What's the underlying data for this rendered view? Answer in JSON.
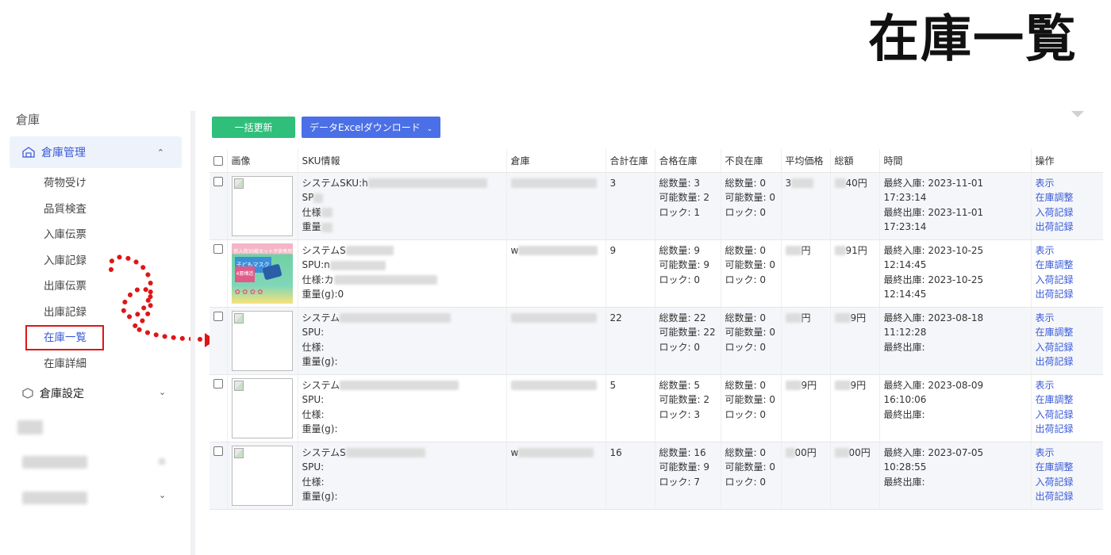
{
  "title": "在庫一覧",
  "sidebar": {
    "header": "倉庫",
    "group_active": {
      "label": "倉庫管理"
    },
    "items": [
      {
        "label": "荷物受け",
        "active": false
      },
      {
        "label": "品質検査",
        "active": false
      },
      {
        "label": "入庫伝票",
        "active": false
      },
      {
        "label": "入庫記録",
        "active": false
      },
      {
        "label": "出庫伝票",
        "active": false
      },
      {
        "label": "出庫記録",
        "active": false
      },
      {
        "label": "在庫一覧",
        "active": true
      },
      {
        "label": "在庫詳細",
        "active": false
      }
    ],
    "group2": {
      "label": "倉庫設定"
    }
  },
  "toolbar": {
    "bulk_update": "一括更新",
    "download": "データExcelダウンロード"
  },
  "table": {
    "columns": [
      "画像",
      "SKU情報",
      "倉庫",
      "合計在庫",
      "合格在庫",
      "不良在庫",
      "平均価格",
      "総額",
      "時間",
      "操作"
    ],
    "actions": [
      "表示",
      "在庫調整",
      "入荷記録",
      "出荷記録"
    ],
    "rows": [
      {
        "sku": [
          "システムSKU:h",
          "SP",
          "仕様",
          "重量"
        ],
        "total": "3",
        "good": [
          "総数量: 3",
          "可能数量: 2",
          "ロック: 1"
        ],
        "bad": [
          "総数量: 0",
          "可能数量: 0",
          "ロック: 0"
        ],
        "avg": "3",
        "sum": "40円",
        "time": [
          "最終入庫: 2023-11-01 17:23:14",
          "最終出庫: 2023-11-01 17:23:14"
        ],
        "image": "broken"
      },
      {
        "sku": [
          "システムS",
          "SPU:n",
          "仕様:カ",
          "重量(g):0"
        ],
        "warehouse": "w",
        "total": "9",
        "good": [
          "総数量: 9",
          "可能数量: 9",
          "ロック: 0"
        ],
        "bad": [
          "総数量: 0",
          "可能数量: 0",
          "ロック: 0"
        ],
        "avg": "円",
        "sum": "91円",
        "time": [
          "最終入庫: 2023-10-25 12:14:45",
          "最終出庫: 2023-10-25 12:14:45"
        ],
        "image": "product",
        "image_text": [
          "新入荷30枚セット子供専用",
          "子どもマスク",
          "4層構造"
        ]
      },
      {
        "sku": [
          "システム",
          "SPU:",
          "仕様:",
          "重量(g):"
        ],
        "total": "22",
        "good": [
          "総数量: 22",
          "可能数量: 22",
          "ロック: 0"
        ],
        "bad": [
          "総数量: 0",
          "可能数量: 0",
          "ロック: 0"
        ],
        "avg": "円",
        "sum": "9円",
        "time": [
          "最終入庫: 2023-08-18 11:12:28",
          "最終出庫:"
        ],
        "image": "broken"
      },
      {
        "sku": [
          "システム",
          "SPU:",
          "仕様:",
          "重量(g):"
        ],
        "total": "5",
        "good": [
          "総数量: 5",
          "可能数量: 2",
          "ロック: 3"
        ],
        "bad": [
          "総数量: 0",
          "可能数量: 0",
          "ロック: 0"
        ],
        "avg": "9円",
        "sum": "9円",
        "time": [
          "最終入庫: 2023-08-09 16:10:06",
          "最終出庫:"
        ],
        "image": "broken"
      },
      {
        "sku": [
          "システムS",
          "SPU:",
          "仕様:",
          "重量(g):"
        ],
        "warehouse": "w",
        "total": "16",
        "good": [
          "総数量: 16",
          "可能数量: 9",
          "ロック: 7"
        ],
        "bad": [
          "総数量: 0",
          "可能数量: 0",
          "ロック: 0"
        ],
        "avg": "00円",
        "sum": "00円",
        "time": [
          "最終入庫: 2023-07-05 10:28:55",
          "最終出庫:"
        ],
        "image": "broken"
      }
    ]
  },
  "colors": {
    "accent": "#3b5bd8",
    "green": "#2fbf7b",
    "blue_btn": "#4b6fe6",
    "highlight": "#e01515"
  }
}
